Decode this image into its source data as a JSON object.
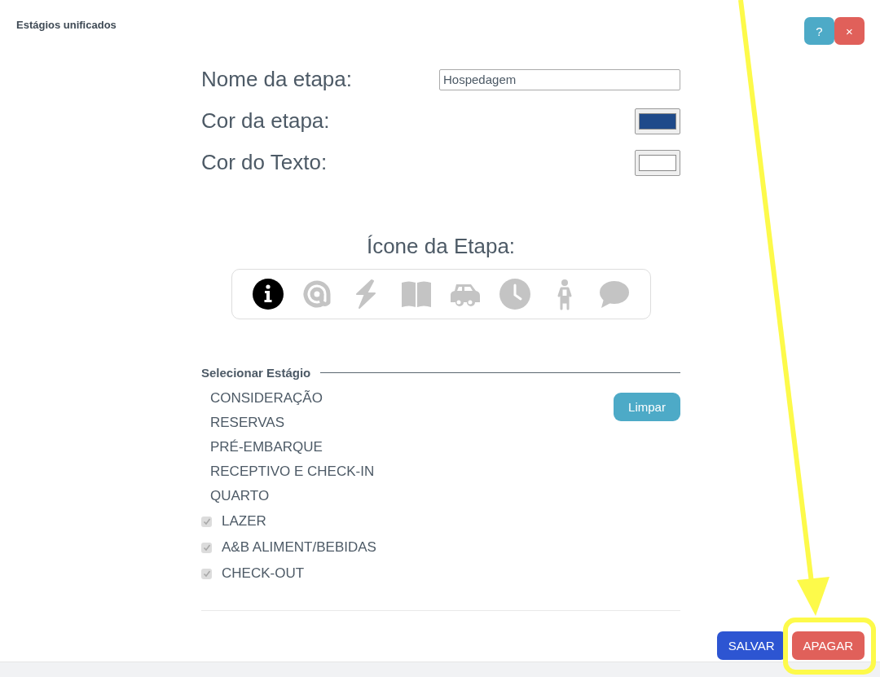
{
  "window": {
    "title": "Estágios unificados"
  },
  "header_buttons": [
    {
      "kind": "help",
      "label": "?"
    },
    {
      "kind": "close",
      "label": "×"
    }
  ],
  "form": [
    {
      "kind": "text",
      "label": "Nome da etapa:",
      "value": "Hospedagem"
    },
    {
      "kind": "color",
      "label": "Cor da etapa:",
      "color": "#1f4a8a"
    },
    {
      "kind": "color",
      "label": "Cor do Texto:",
      "color": "#ffffff"
    }
  ],
  "icon_picker": {
    "title": "Ícone da Etapa:",
    "icons": [
      {
        "kind": "info",
        "selected": true
      },
      {
        "kind": "at",
        "selected": false
      },
      {
        "kind": "bolt",
        "selected": false
      },
      {
        "kind": "book",
        "selected": false
      },
      {
        "kind": "car",
        "selected": false
      },
      {
        "kind": "clock",
        "selected": false
      },
      {
        "kind": "person",
        "selected": false
      },
      {
        "kind": "chat",
        "selected": false
      }
    ]
  },
  "stages": {
    "title": "Selecionar Estágio",
    "clear_button": "Limpar",
    "items": [
      {
        "kind": "plain",
        "label": "CONSIDERAÇÃO"
      },
      {
        "kind": "plain",
        "label": "RESERVAS"
      },
      {
        "kind": "plain",
        "label": "PRÉ-EMBARQUE"
      },
      {
        "kind": "plain",
        "label": "RECEPTIVO E CHECK-IN"
      },
      {
        "kind": "plain",
        "label": "QUARTO"
      },
      {
        "kind": "checkbox",
        "label": "LAZER",
        "checked": true,
        "disabled": true
      },
      {
        "kind": "checkbox",
        "label": "A&B ALIMENT/BEBIDAS",
        "checked": true,
        "disabled": true
      },
      {
        "kind": "checkbox",
        "label": "CHECK-OUT",
        "checked": true,
        "disabled": true
      }
    ]
  },
  "footer_buttons": [
    {
      "kind": "save",
      "label": "SALVAR"
    },
    {
      "kind": "delete",
      "label": "APAGAR"
    }
  ]
}
